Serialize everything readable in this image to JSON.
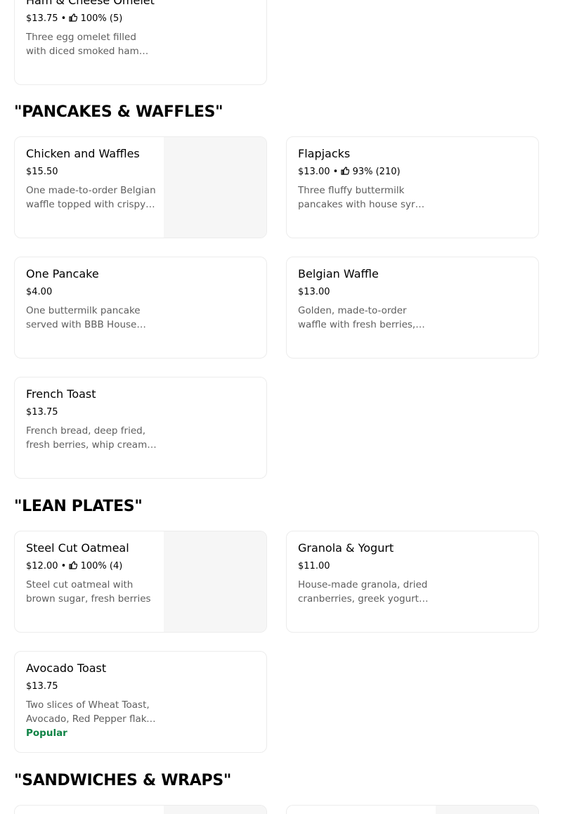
{
  "colors": {
    "accent_green": "#0e8345",
    "muted_text": "#5e5e5e",
    "card_border": "#ececec",
    "image_placeholder": "#f6f6f6"
  },
  "top_item": {
    "name": "Ham & Cheese Omelet",
    "price": "$13.75",
    "rating": "100% (5)",
    "desc": "Three egg omelet filled with diced smoked ham and cheese"
  },
  "sections": [
    {
      "title": "\"PANCAKES & WAFFLES\"",
      "items": [
        {
          "name": "Chicken and Waffles",
          "price": "$15.50",
          "rating": "",
          "desc": "One made-to-order Belgian waffle topped with crispy fried chicken",
          "has_image": true
        },
        {
          "name": "Flapjacks",
          "price": "$13.00",
          "rating": "93% (210)",
          "desc": "Three fluffy buttermilk pancakes with house syrup and butter"
        },
        {
          "name": "One Pancake",
          "price": "$4.00",
          "rating": "",
          "desc": "One buttermilk pancake served with BBB House syrup"
        },
        {
          "name": "Belgian Waffle",
          "price": "$13.00",
          "rating": "",
          "desc": "Golden, made-to-order waffle with fresh berries, whip cream"
        },
        {
          "name": "French Toast",
          "price": "$13.75",
          "rating": "",
          "desc": "French bread, deep fried, fresh berries, whip cream, powdered sugar"
        }
      ]
    },
    {
      "title": "\"LEAN PLATES\"",
      "items": [
        {
          "name": "Steel Cut Oatmeal",
          "price": "$12.00",
          "rating": "100% (4)",
          "desc": "Steel cut oatmeal with brown sugar, fresh berries",
          "has_image": true
        },
        {
          "name": "Granola & Yogurt",
          "price": "$11.00",
          "rating": "",
          "desc": "House-made granola, dried cranberries, greek yogurt, honey"
        },
        {
          "name": "Avocado Toast",
          "price": "$13.75",
          "rating": "",
          "desc": "Two slices of Wheat Toast, Avocado, Red Pepper flake, sea salt",
          "badge": "Popular"
        }
      ]
    },
    {
      "title": "\"SANDWICHES & WRAPS\"",
      "items": []
    }
  ]
}
